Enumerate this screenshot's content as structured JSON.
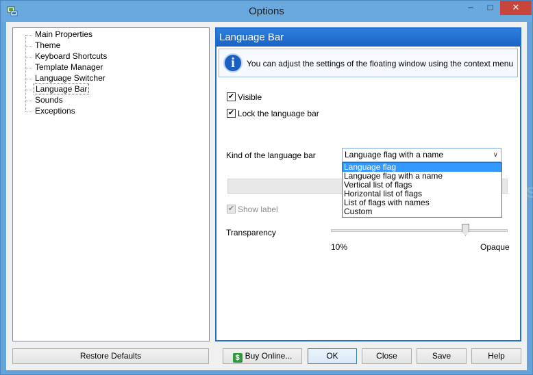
{
  "window": {
    "title": "Options",
    "minimize_glyph": "–",
    "maximize_glyph": "□",
    "close_glyph": "✕"
  },
  "tree": {
    "items": [
      {
        "label": "Main Properties",
        "selected": false
      },
      {
        "label": "Theme",
        "selected": false
      },
      {
        "label": "Keyboard Shortcuts",
        "selected": false
      },
      {
        "label": "Template Manager",
        "selected": false
      },
      {
        "label": "Language Switcher",
        "selected": false
      },
      {
        "label": "Language Bar",
        "selected": true
      },
      {
        "label": "Sounds",
        "selected": false
      },
      {
        "label": "Exceptions",
        "selected": false
      }
    ]
  },
  "panel": {
    "header": "Language Bar",
    "info_icon_glyph": "i",
    "info_text": "You can adjust the settings of the floating window using the context menu",
    "visible_label": "Visible",
    "visible_checked": true,
    "lock_label": "Lock the language bar",
    "lock_checked": true,
    "check_glyph": "✔",
    "kind_label": "Kind of the language bar",
    "kind_selected": "Language flag with a name",
    "kind_options": [
      "Language flag",
      "Language flag with a name",
      "Vertical list of flags",
      "Horizontal list of flags",
      "List of flags with names",
      "Custom"
    ],
    "kind_highlighted_index": 0,
    "dropdown_arrow_glyph": "∨",
    "show_label": "Show label",
    "show_label_checked": true,
    "transparency_label": "Transparency",
    "slider_min_label": "10%",
    "slider_max_label": "Opaque"
  },
  "buttons": {
    "restore_defaults": "Restore Defaults",
    "buy_online": "Buy Online...",
    "buy_icon_glyph": "$",
    "ok": "OK",
    "close": "Close",
    "save": "Save",
    "help": "Help"
  },
  "watermark": "SOFTPEDIA"
}
